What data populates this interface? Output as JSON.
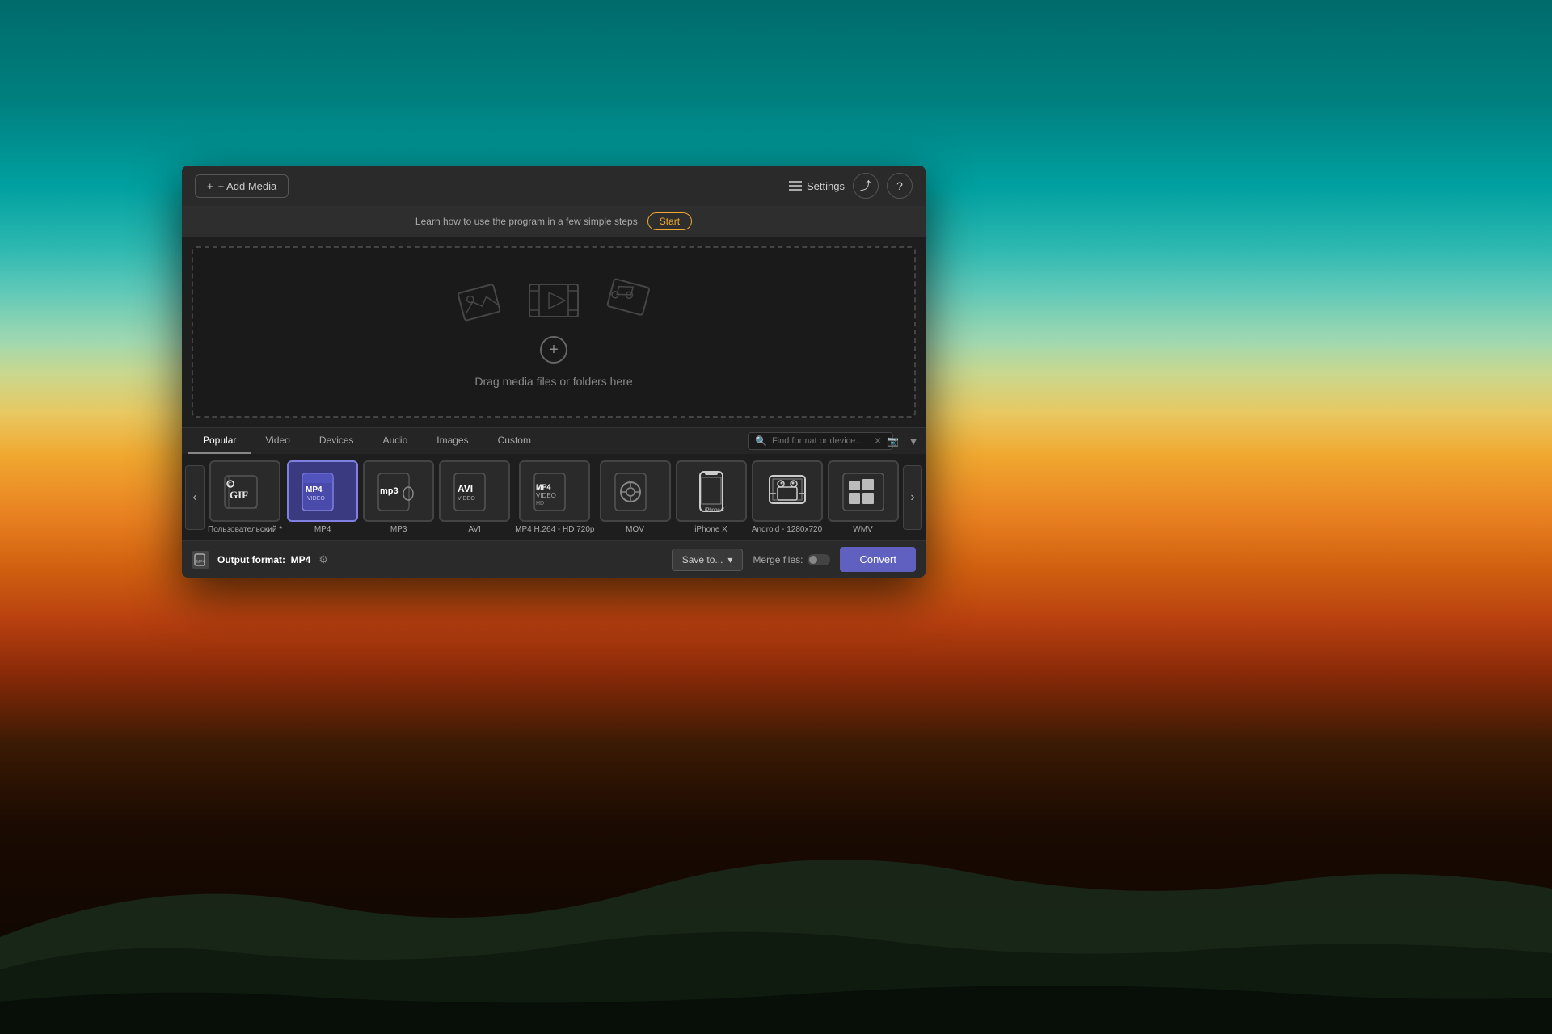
{
  "background": {
    "alt": "Sunset landscape with teal sky and orange horizon"
  },
  "app": {
    "titlebar": {
      "add_media_label": "+ Add Media",
      "settings_label": "Settings",
      "share_icon": "⤴",
      "help_icon": "?"
    },
    "tutorial_bar": {
      "text": "Learn how to use the program in a few simple steps",
      "start_label": "Start"
    },
    "drop_zone": {
      "drag_text": "Drag media files or folders here",
      "add_icon": "+"
    },
    "format_tabs": {
      "tabs": [
        {
          "id": "popular",
          "label": "Popular",
          "active": true
        },
        {
          "id": "video",
          "label": "Video",
          "active": false
        },
        {
          "id": "devices",
          "label": "Devices",
          "active": false
        },
        {
          "id": "audio",
          "label": "Audio",
          "active": false
        },
        {
          "id": "images",
          "label": "Images",
          "active": false
        },
        {
          "id": "custom",
          "label": "Custom",
          "active": false
        }
      ],
      "search_placeholder": "Find format or device..."
    },
    "formats": [
      {
        "id": "custom",
        "label": "Пользовательский *",
        "type": "gif",
        "selected": false
      },
      {
        "id": "mp4",
        "label": "MP4",
        "type": "mp4",
        "selected": true
      },
      {
        "id": "mp3",
        "label": "MP3",
        "type": "mp3",
        "selected": false
      },
      {
        "id": "avi",
        "label": "AVI",
        "type": "avi",
        "selected": false
      },
      {
        "id": "mp4hd",
        "label": "MP4 H.264 - HD 720p",
        "type": "mp4hd",
        "selected": false
      },
      {
        "id": "mov",
        "label": "MOV",
        "type": "mov",
        "selected": false
      },
      {
        "id": "iphone",
        "label": "iPhone X",
        "type": "iphone",
        "selected": false
      },
      {
        "id": "android",
        "label": "Android - 1280x720",
        "type": "android",
        "selected": false
      },
      {
        "id": "wmv",
        "label": "WMV",
        "type": "wmv",
        "selected": false
      }
    ],
    "bottom_bar": {
      "output_format_prefix": "Output format:",
      "output_format_value": "MP4",
      "save_to_label": "Save to...",
      "merge_files_label": "Merge files:",
      "convert_label": "Convert"
    }
  }
}
